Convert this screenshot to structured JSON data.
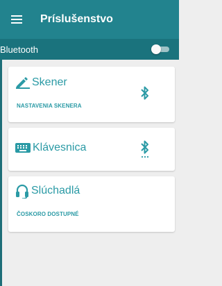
{
  "appbar": {
    "menu_icon": "hamburger-menu-icon",
    "title": "Príslušenstvo"
  },
  "bluetooth": {
    "label": "Bluetooth",
    "enabled": false
  },
  "cards": [
    {
      "title": "Skener",
      "subtitle": "NASTAVENIA SKENERA",
      "icon": "pen-icon",
      "status_icon": "bluetooth-icon"
    },
    {
      "title": "Klávesnica",
      "icon": "keyboard-icon",
      "status_icon": "bluetooth-searching-icon"
    },
    {
      "title": "Slúchadlá",
      "subtitle": "ČOSKORO DOSTUPNÉ",
      "icon": "headset-icon"
    }
  ],
  "colors": {
    "primary": "#22838e",
    "primary_dark": "#1a737d",
    "accent": "#2a9aa5",
    "background": "#eeeeee",
    "card": "#ffffff"
  }
}
